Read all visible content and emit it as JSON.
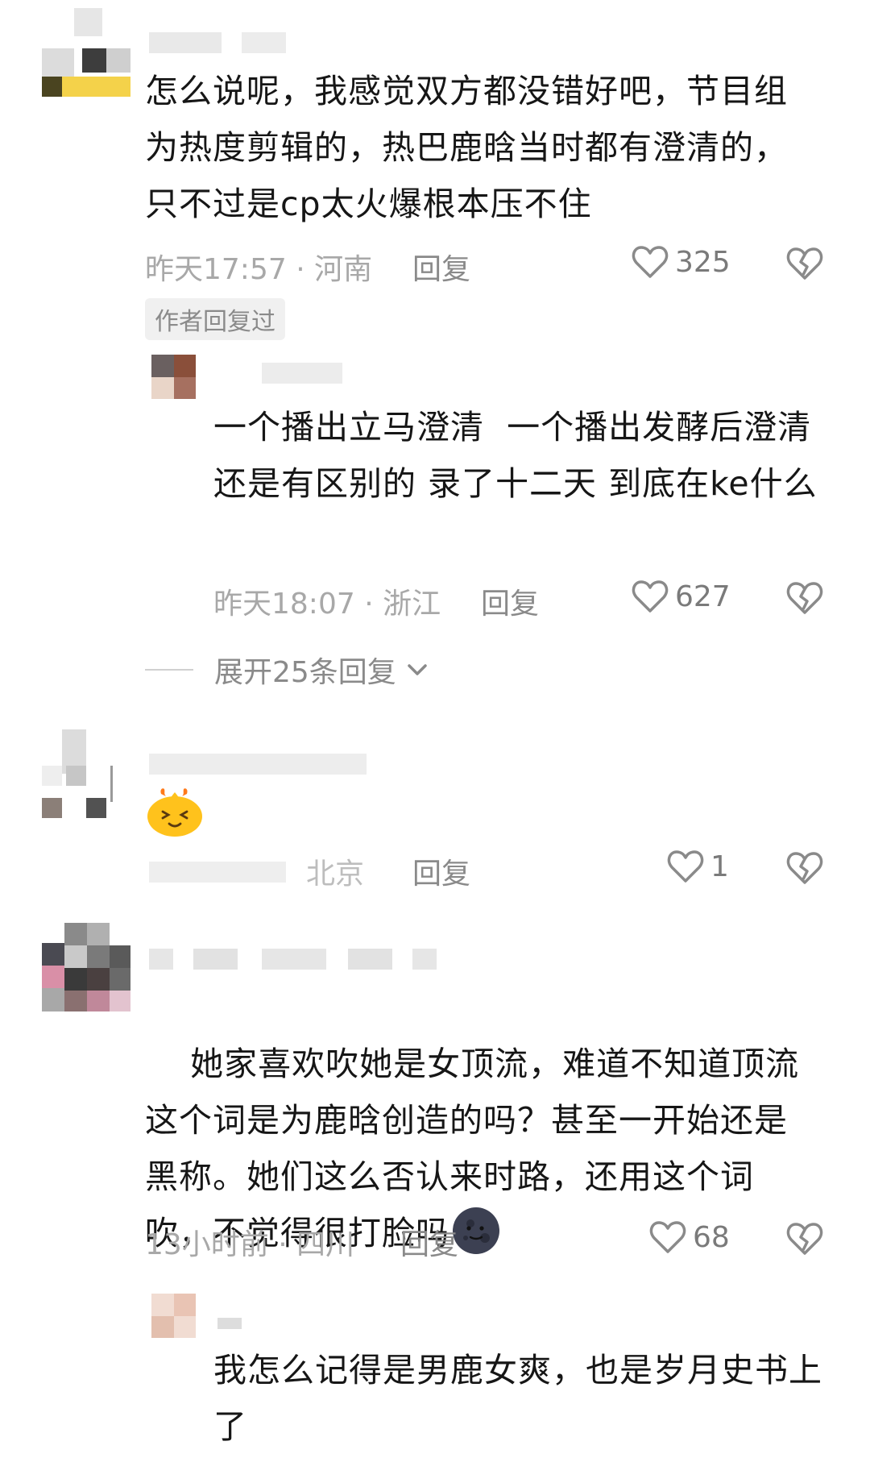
{
  "comments": [
    {
      "text": "怎么说呢，我感觉双方都没错好吧，节目组为热度剪辑的，热巴鹿晗当时都有澄清的，只不过是cp太火爆根本压不住",
      "time": "昨天17:57",
      "location": "河南",
      "reply_label": "回复",
      "likes": "325",
      "author_badge": "作者回复过",
      "replies": [
        {
          "text": "一个播出立马澄清  一个播出发酵后澄清还是有区别的 录了十二天 到底在ke什么",
          "time": "昨天18:07",
          "location": "浙江",
          "reply_label": "回复",
          "likes": "627"
        }
      ],
      "expand_label": "展开25条回复"
    },
    {
      "text": "",
      "emoji": "fire-face-emoji",
      "time": "",
      "location": "北京",
      "reply_label": "回复",
      "likes": "1"
    },
    {
      "text": "她家喜欢吹她是女顶流，难道不知道顶流这个词是为鹿晗创造的吗？甚至一开始还是黑称。她们这么否认来时路，还用这个词吹，不觉得很打脸吗",
      "emoji": "dark-moon-emoji",
      "time": "13小时前",
      "location": "四川",
      "reply_label": "回复",
      "likes": "68",
      "replies": [
        {
          "text": "我怎么记得是男鹿女爽，也是岁月史书上了"
        }
      ]
    }
  ],
  "meta_separator": "·",
  "colors": {
    "text": "#161616",
    "meta": "#a8a8a8",
    "icon": "#8a8a8a",
    "badge_bg": "#f0f0f0"
  }
}
